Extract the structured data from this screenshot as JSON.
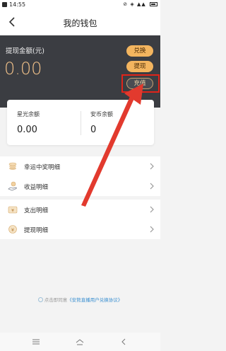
{
  "status_bar": {
    "time": "14:55",
    "right_icons": "⊘ ◈ ▲▲"
  },
  "nav": {
    "title": "我的钱包"
  },
  "withdraw": {
    "label": "提现金额(元)",
    "amount": "0.00"
  },
  "actions": {
    "exchange": "兑换",
    "withdraw": "提现",
    "recharge": "充值"
  },
  "balances": [
    {
      "label": "星光余额",
      "value": "0.00"
    },
    {
      "label": "安币余额",
      "value": "0"
    }
  ],
  "menu_group_1": [
    {
      "label": "幸运中奖明细",
      "icon": "coins-icon"
    },
    {
      "label": "收益明细",
      "icon": "hand-coin-icon"
    }
  ],
  "menu_group_2": [
    {
      "label": "支出明细",
      "icon": "expense-icon"
    },
    {
      "label": "提现明细",
      "icon": "withdraw-record-icon"
    }
  ],
  "agreement": {
    "prefix": "点击即同意",
    "link": "《安熊直播用户兑换协议》"
  },
  "colors": {
    "gold": "#f3b55f",
    "dark_panel": "#3b3d42",
    "highlight": "#e0241a",
    "link": "#3a8fd0"
  }
}
